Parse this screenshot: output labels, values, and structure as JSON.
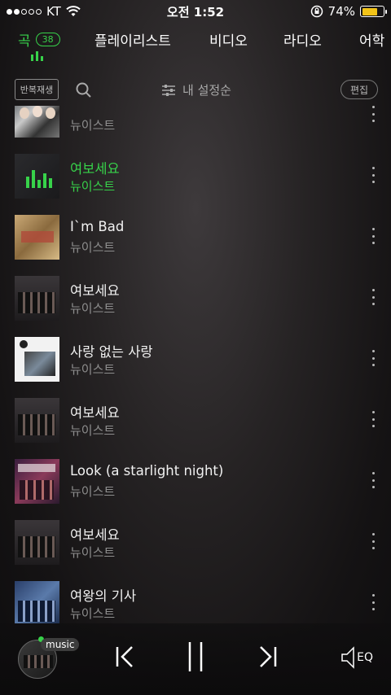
{
  "status": {
    "carrier": "KT",
    "time": "오전 1:52",
    "battery": "74%",
    "battery_level": 0.74,
    "signal_bars": 2
  },
  "tabs": [
    {
      "label": "곡",
      "badge": "38"
    },
    {
      "label": "플레이리스트"
    },
    {
      "label": "비디오"
    },
    {
      "label": "라디오"
    },
    {
      "label": "어학"
    }
  ],
  "toolbar": {
    "repeat_label": "반복재생",
    "sort_label": "내 설정순",
    "edit_label": "편집"
  },
  "songs": [
    {
      "title": "",
      "artist": "뉴이스트"
    },
    {
      "title": "여보세요",
      "artist": "뉴이스트",
      "playing": true
    },
    {
      "title": "I`m Bad",
      "artist": "뉴이스트"
    },
    {
      "title": "여보세요",
      "artist": "뉴이스트"
    },
    {
      "title": "사랑 없는 사랑",
      "artist": "뉴이스트"
    },
    {
      "title": "여보세요",
      "artist": "뉴이스트"
    },
    {
      "title": "Look (a starlight night)",
      "artist": "뉴이스트"
    },
    {
      "title": "여보세요",
      "artist": "뉴이스트"
    },
    {
      "title": "여왕의 기사",
      "artist": "뉴이스트"
    }
  ],
  "player": {
    "source_label": "music",
    "eq_label": "EQ"
  },
  "colors": {
    "accent": "#37d24a",
    "battery": "#f2c318"
  }
}
